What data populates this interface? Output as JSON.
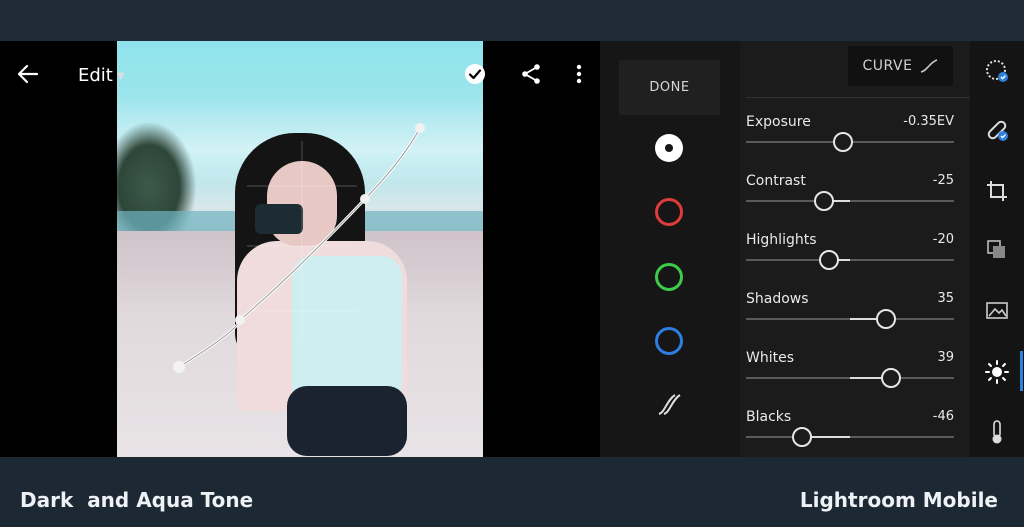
{
  "header": {
    "title": "Edit"
  },
  "channels": {
    "done_label": "DONE",
    "items": [
      {
        "name": "rgb",
        "color": "#ffffff"
      },
      {
        "name": "red",
        "color": "#e03a3a"
      },
      {
        "name": "green",
        "color": "#3ccc4a"
      },
      {
        "name": "blue",
        "color": "#2e7de0"
      }
    ]
  },
  "panel": {
    "curve_label": "CURVE",
    "sliders": [
      {
        "label": "Exposure",
        "value": "-0.35EV",
        "numeric": -0.35,
        "min": -5,
        "max": 5
      },
      {
        "label": "Contrast",
        "value": "-25",
        "numeric": -25,
        "min": -100,
        "max": 100
      },
      {
        "label": "Highlights",
        "value": "-20",
        "numeric": -20,
        "min": -100,
        "max": 100
      },
      {
        "label": "Shadows",
        "value": "35",
        "numeric": 35,
        "min": -100,
        "max": 100
      },
      {
        "label": "Whites",
        "value": "39",
        "numeric": 39,
        "min": -100,
        "max": 100
      },
      {
        "label": "Blacks",
        "value": "-46",
        "numeric": -46,
        "min": -100,
        "max": 100
      }
    ]
  },
  "rail": {
    "icons": [
      "presets-icon",
      "healing-icon",
      "crop-icon",
      "profiles-icon",
      "selective-icon",
      "light-icon",
      "color-icon"
    ],
    "active_icon": "light-icon",
    "accent": "#2f7fdc"
  },
  "captions": {
    "left": "Dark  and Aqua Tone",
    "right": "Lightroom Mobile"
  }
}
